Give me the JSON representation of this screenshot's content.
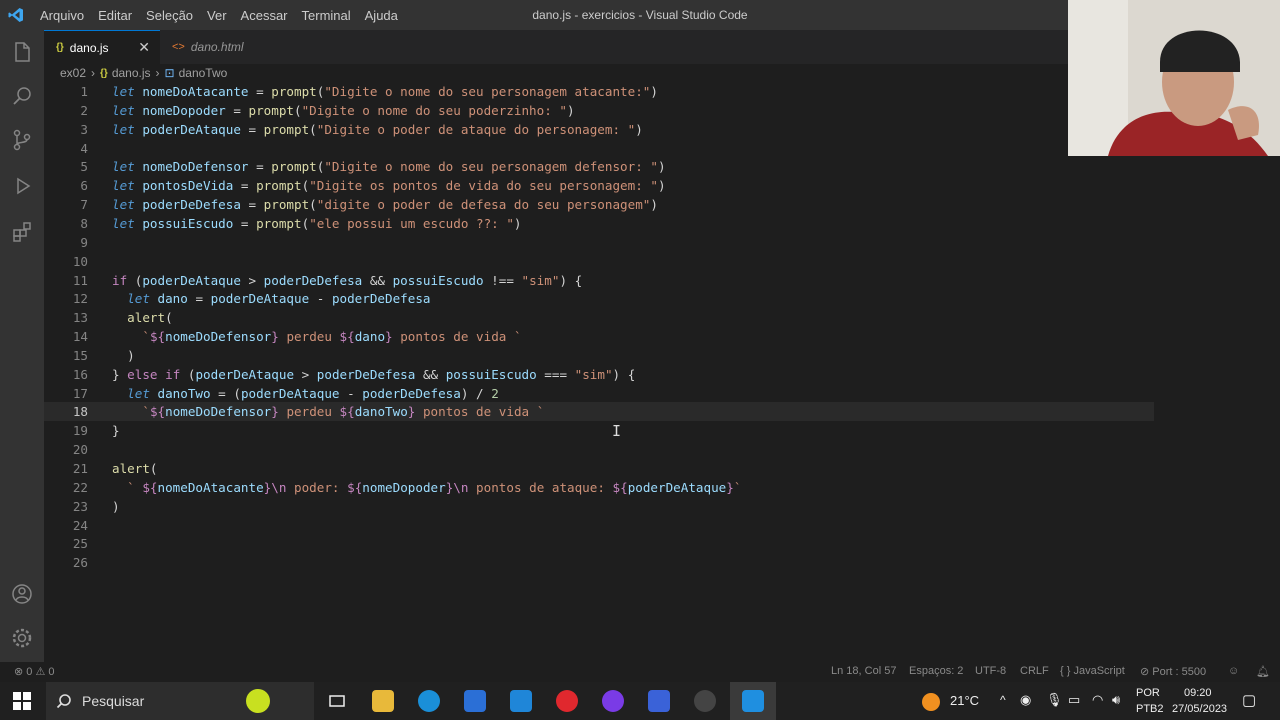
{
  "menu": [
    "Arquivo",
    "Editar",
    "Seleção",
    "Ver",
    "Acessar",
    "Terminal",
    "Ajuda"
  ],
  "window_title": "dano.js - exercicios - Visual Studio Code",
  "tabs": [
    {
      "label": "dano.js",
      "icon": "js-file-icon",
      "active": true
    },
    {
      "label": "dano.html",
      "icon": "html-file-icon",
      "active": false
    }
  ],
  "breadcrumb": [
    "ex02",
    "dano.js",
    "danoTwo"
  ],
  "code_lines": [
    "let nomeDoAtacante = prompt(\"Digite o nome do seu personagem atacante:\")",
    "let nomeDopoder = prompt(\"Digite o nome do seu poderzinho: \")",
    "let poderDeAtaque = prompt(\"Digite o poder de ataque do personagem: \")",
    "",
    "let nomeDoDefensor = prompt(\"Digite o nome do seu personagem defensor: \")",
    "let pontosDeVida = prompt(\"Digite os pontos de vida do seu personagem: \")",
    "let poderDeDefesa = prompt(\"digite o poder de defesa do seu personagem\")",
    "let possuiEscudo = prompt(\"ele possui um escudo ??: \")",
    "",
    "",
    "if (poderDeAtaque > poderDeDefesa && possuiEscudo !== \"sim\") {",
    "  let dano = poderDeAtaque - poderDeDefesa",
    "  alert(",
    "    `${nomeDoDefensor} perdeu ${dano} pontos de vida `",
    "  )",
    "} else if (poderDeAtaque > poderDeDefesa && possuiEscudo === \"sim\") {",
    "  let danoTwo = (poderDeAtaque - poderDeDefesa) / 2",
    "    `${nomeDoDefensor} perdeu ${danoTwo} pontos de vida `",
    "}",
    "",
    "alert(",
    "  ` ${nomeDoAtacante}\\n poder: ${nomeDopoder}\\n pontos de ataque: ${poderDeAtaque}`",
    ")",
    "",
    "",
    ""
  ],
  "current_line": 18,
  "status": {
    "problems": "⊗ 0 ⚠ 0",
    "position": "Ln 18, Col 57",
    "spaces": "Espaços: 2",
    "encoding": "UTF-8",
    "eol": "CRLF",
    "language": "{ } JavaScript",
    "port": "⊘ Port : 5500"
  },
  "taskbar": {
    "search_placeholder": "Pesquisar",
    "temperature": "21°C",
    "lang": "POR",
    "layout": "PTB2",
    "time": "09:20",
    "date": "27/05/2023"
  }
}
